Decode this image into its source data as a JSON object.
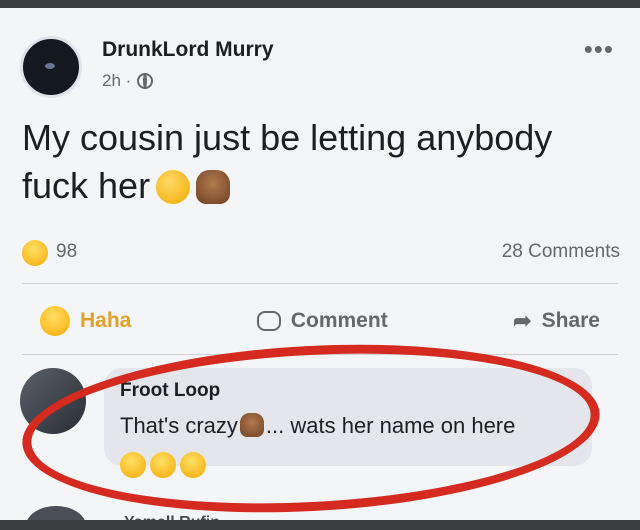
{
  "post": {
    "author": "DrunkLord Murry",
    "time": "2h ·",
    "text": "My cousin just be letting anybody fuck her",
    "text_emojis": [
      "unamused-face",
      "person-facepalming"
    ],
    "reaction_count": "98",
    "comments_count": "28 Comments"
  },
  "actions": {
    "haha_label": "Haha",
    "comment_label": "Comment",
    "share_label": "Share"
  },
  "comment": {
    "author": "Froot Loop",
    "text_before": "That's crazy",
    "text_after": "... wats her name on here",
    "laugh_emojis": [
      "tears-of-joy",
      "tears-of-joy",
      "tears-of-joy"
    ]
  },
  "next_comment": {
    "author": "Yamell Rufin"
  },
  "colors": {
    "annotation_circle": "#d42a1f",
    "haha_active": "#e0a12a"
  }
}
